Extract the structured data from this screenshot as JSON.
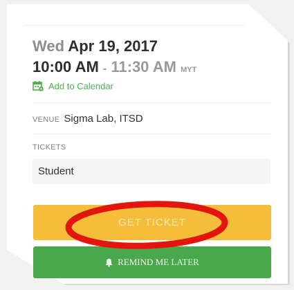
{
  "event": {
    "date_dow": "Wed",
    "date_rest": "Apr 19, 2017",
    "time_start": "10:00 AM",
    "time_sep": "-",
    "time_end": "11:30 AM",
    "timezone": "MYT",
    "add_to_calendar": "Add to Calendar"
  },
  "venue": {
    "label": "VENUE",
    "value": "Sigma Lab, ITSD"
  },
  "tickets": {
    "label": "TICKETS",
    "selected": "Student"
  },
  "actions": {
    "get_ticket": "GET TICKET",
    "remind_later": "REMIND ME LATER"
  },
  "colors": {
    "get_ticket_bg": "#f4be3b",
    "remind_bg": "#4aa84c",
    "calendar_link": "#4cae4c",
    "annotation_ring": "#e3150f"
  },
  "icons": {
    "calendar": "calendar-plus-icon",
    "bell": "bell-icon"
  }
}
